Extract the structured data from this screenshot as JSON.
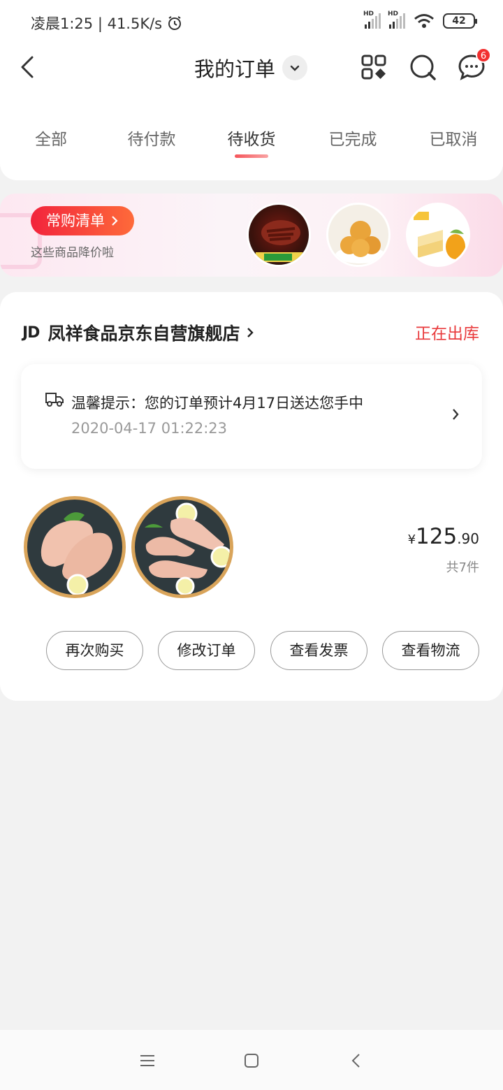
{
  "status_bar": {
    "time_speed": "凌晨1:25 | 41.5K/s",
    "hd1": "HD",
    "hd2": "HD",
    "battery": "42"
  },
  "header": {
    "title": "我的订单",
    "message_badge": "6"
  },
  "tabs": [
    {
      "label": "全部"
    },
    {
      "label": "待付款"
    },
    {
      "label": "待收货"
    },
    {
      "label": "已完成"
    },
    {
      "label": "已取消"
    }
  ],
  "active_tab": "待收货",
  "banner": {
    "pill_label": "常购清单",
    "subtitle": "这些商品降价啦"
  },
  "order": {
    "shop_logo": "JD",
    "shop_name": "凤祥食品京东自营旗舰店",
    "status": "正在出库",
    "tip_text": "温馨提示：您的订单预计4月17日送达您手中",
    "tip_time": "2020-04-17 01:22:23",
    "price_currency": "¥",
    "price_int": "125",
    "price_dec": ".90",
    "count": "共7件",
    "buttons": [
      {
        "label": "再次购买"
      },
      {
        "label": "修改订单"
      },
      {
        "label": "查看发票"
      },
      {
        "label": "查看物流"
      }
    ]
  },
  "colors": {
    "accent": "#e93b3d",
    "pill_start": "#f2243c",
    "pill_end": "#fe6a3a"
  }
}
